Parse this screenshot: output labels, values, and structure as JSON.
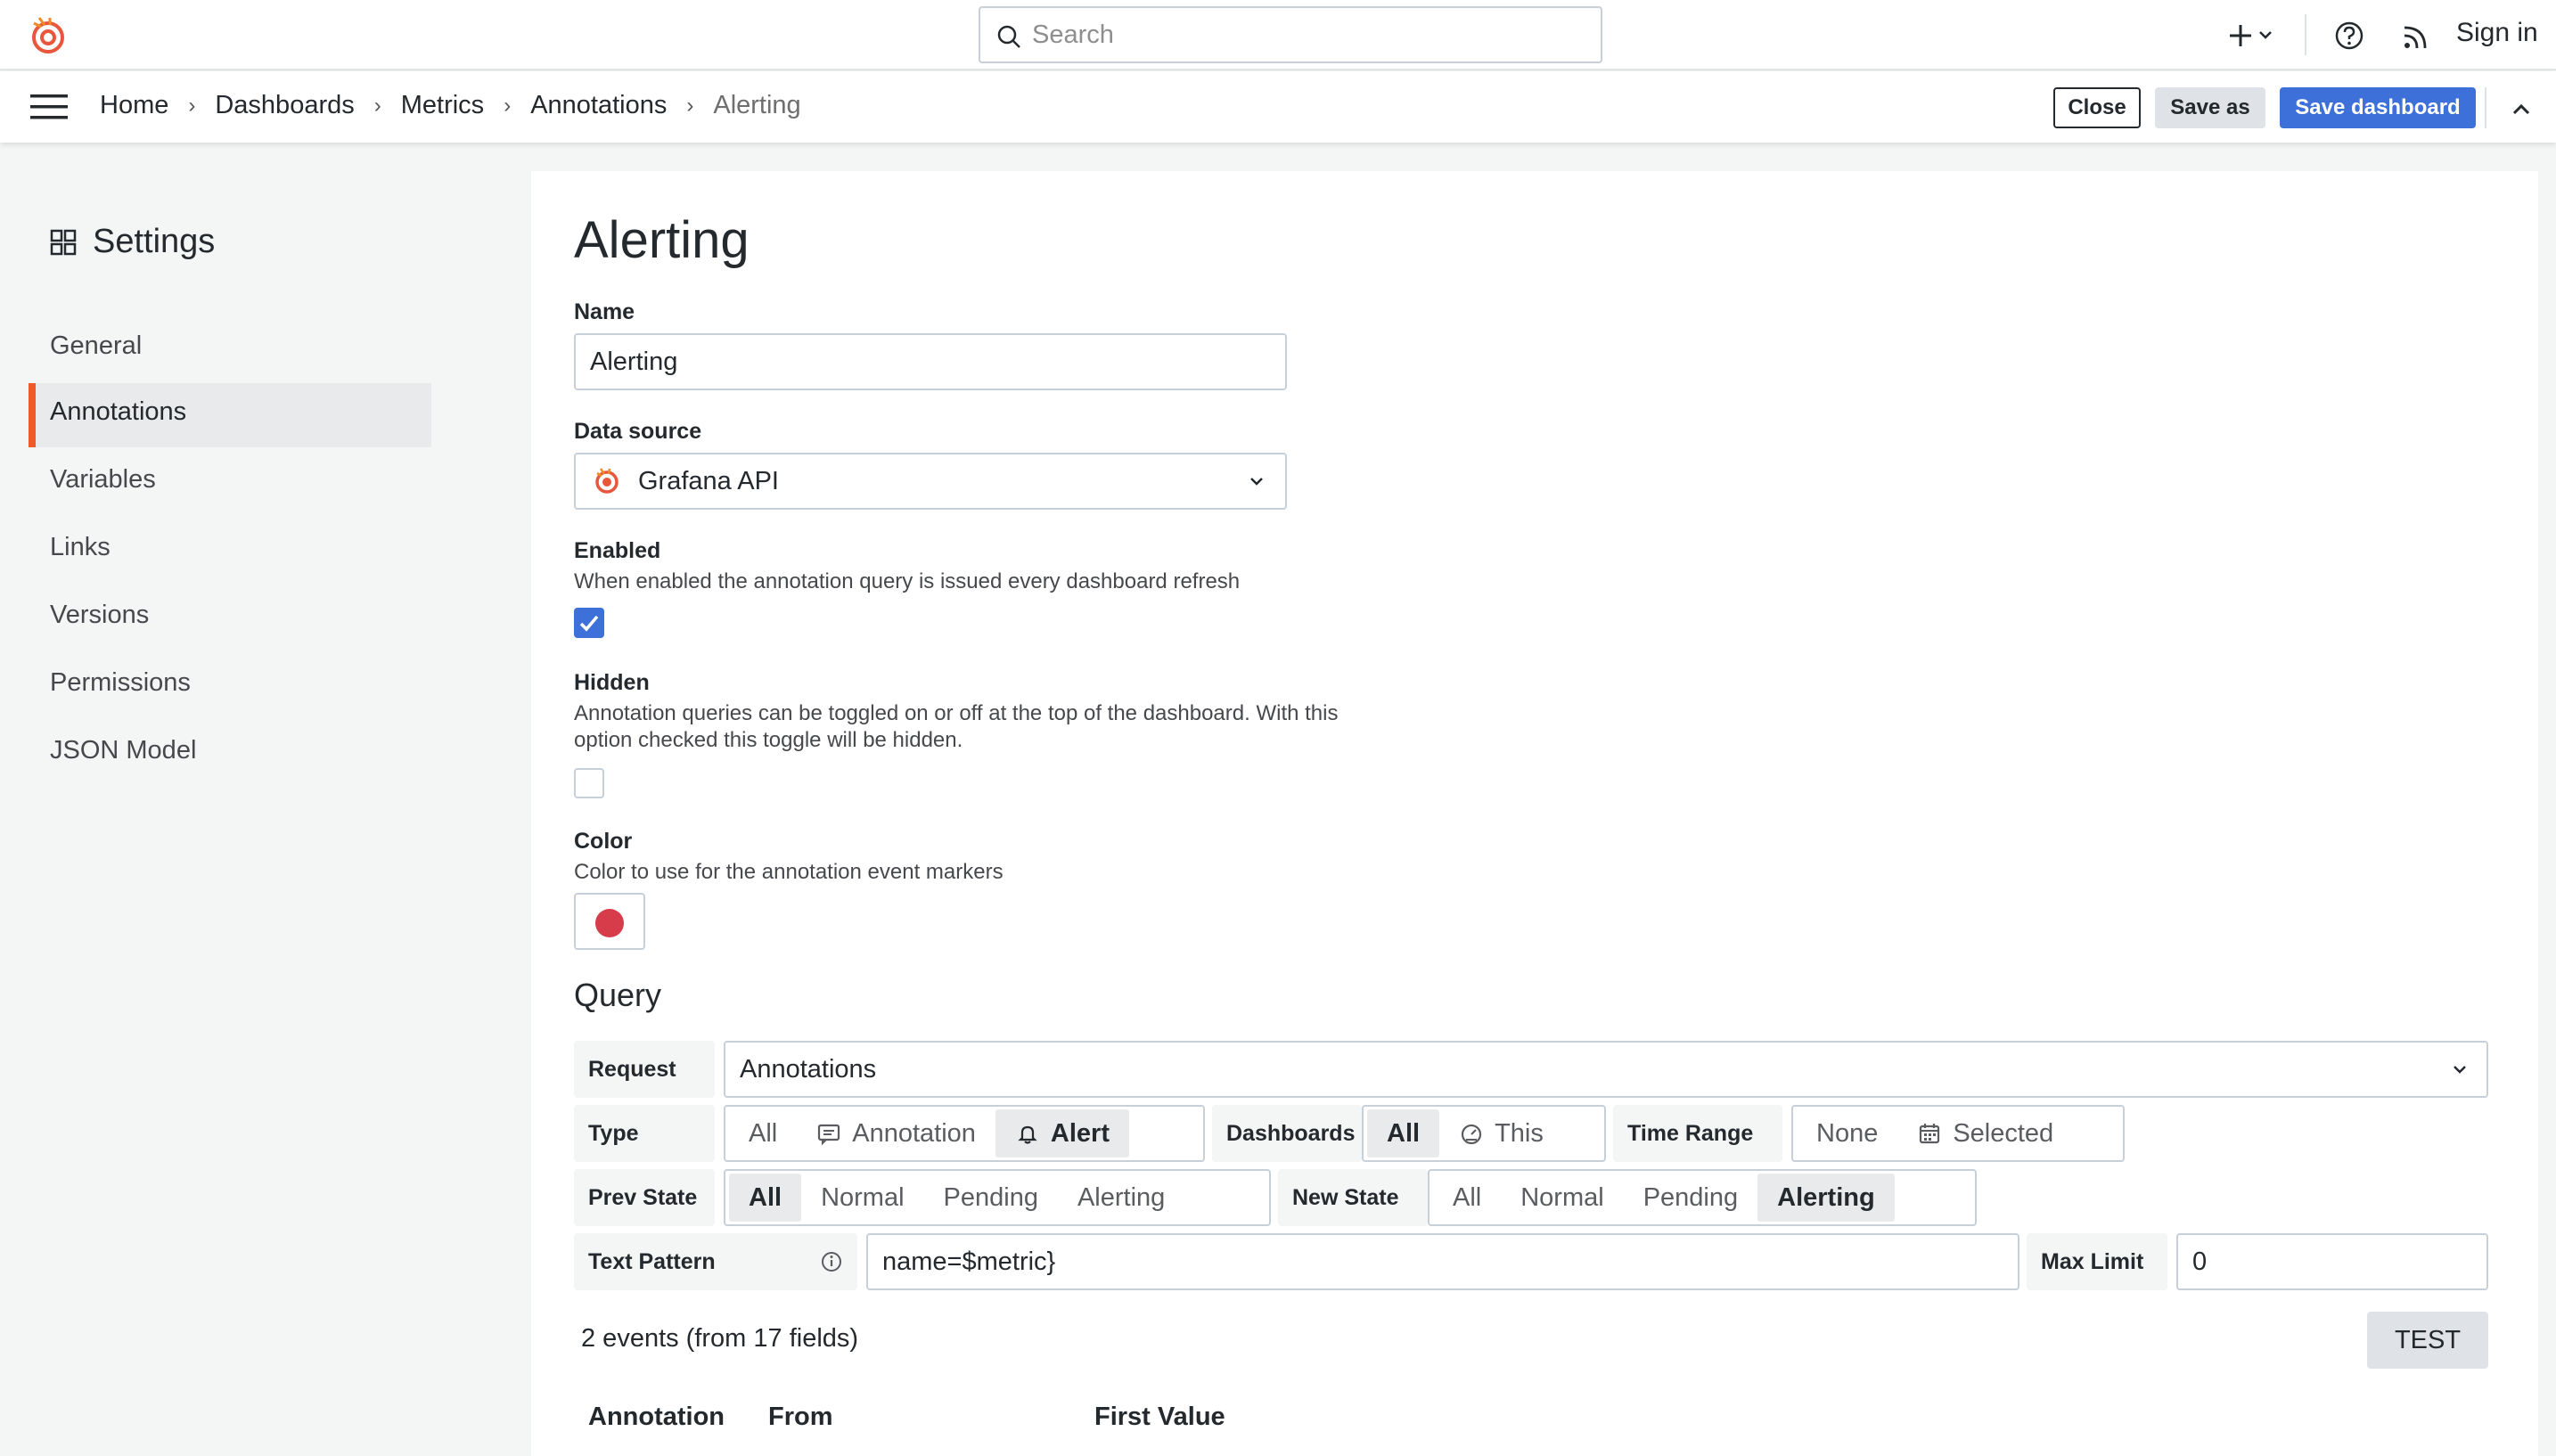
{
  "topbar": {
    "search_placeholder": "Search",
    "sign_in": "Sign in",
    "icons": [
      "grafana-logo-icon",
      "search-icon",
      "plus-icon",
      "chevron-down-icon",
      "help-icon",
      "rss-icon"
    ]
  },
  "breadcrumbs": [
    "Home",
    "Dashboards",
    "Metrics",
    "Annotations",
    "Alerting"
  ],
  "actions": {
    "close": "Close",
    "save_as": "Save as",
    "save_dashboard": "Save dashboard"
  },
  "sidebar": {
    "title": "Settings",
    "items": [
      {
        "label": "General"
      },
      {
        "label": "Annotations",
        "active": true
      },
      {
        "label": "Variables"
      },
      {
        "label": "Links"
      },
      {
        "label": "Versions"
      },
      {
        "label": "Permissions"
      },
      {
        "label": "JSON Model"
      }
    ]
  },
  "form": {
    "title": "Alerting",
    "name_label": "Name",
    "name_value": "Alerting",
    "datasource_label": "Data source",
    "datasource_value": "Grafana API",
    "enabled_label": "Enabled",
    "enabled_desc": "When enabled the annotation query is issued every dashboard refresh",
    "enabled": true,
    "hidden_label": "Hidden",
    "hidden_desc_1": "Annotation queries can be toggled on or off at the top of the dashboard. With this",
    "hidden_desc_2": "option checked this toggle will be hidden.",
    "hidden": false,
    "color_label": "Color",
    "color_desc": "Color to use for the annotation event markers",
    "color_value": "#d63c49"
  },
  "query": {
    "title": "Query",
    "request_label": "Request",
    "request_value": "Annotations",
    "type_label": "Type",
    "type_options": [
      "All",
      "Annotation",
      "Alert"
    ],
    "type_selected": "Alert",
    "dashboards_label": "Dashboards",
    "dashboards_options": [
      "All",
      "This"
    ],
    "dashboards_selected": "All",
    "time_range_label": "Time Range",
    "time_range_options": [
      "None",
      "Selected"
    ],
    "time_range_selected": null,
    "prev_state_label": "Prev State",
    "prev_state_options": [
      "All",
      "Normal",
      "Pending",
      "Alerting"
    ],
    "prev_state_selected": "All",
    "new_state_label": "New State",
    "new_state_options": [
      "All",
      "Normal",
      "Pending",
      "Alerting"
    ],
    "new_state_selected": "Alerting",
    "text_pattern_label": "Text Pattern",
    "text_pattern_value": "name=$metric}",
    "max_limit_label": "Max Limit",
    "max_limit_value": "0"
  },
  "results": {
    "summary": "2 events (from 17 fields)",
    "test_button": "TEST",
    "columns": [
      "Annotation",
      "From",
      "First Value"
    ]
  }
}
